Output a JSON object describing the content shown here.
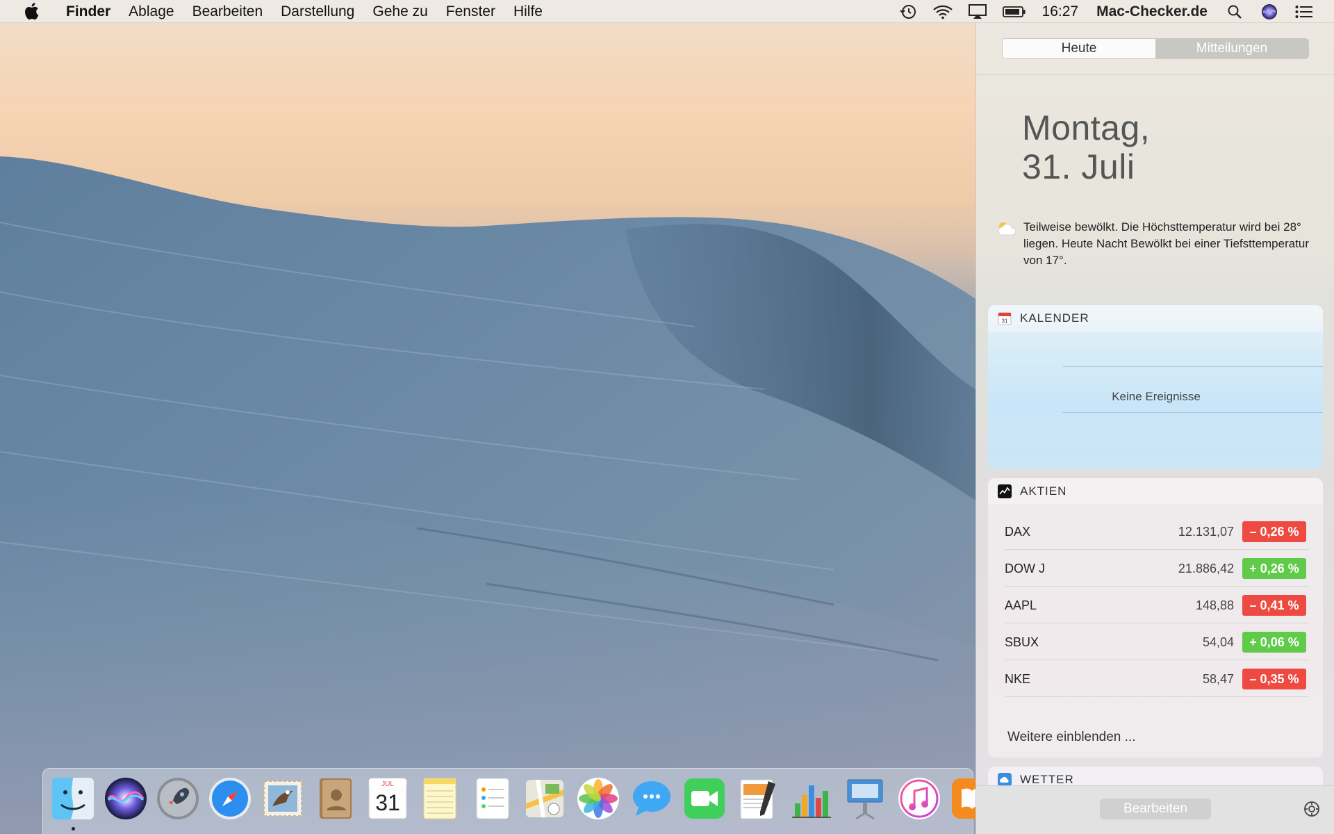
{
  "menubar": {
    "apple_icon": "apple-logo-icon",
    "app_name": "Finder",
    "items": [
      "Ablage",
      "Bearbeiten",
      "Darstellung",
      "Gehe zu",
      "Fenster",
      "Hilfe"
    ],
    "status_icons": [
      "time-machine-icon",
      "wifi-icon",
      "airplay-icon",
      "battery-icon"
    ],
    "clock": "16:27",
    "account": "Mac-Checker.de",
    "right_icons": [
      "spotlight-icon",
      "siri-icon",
      "notification-center-icon"
    ]
  },
  "notification_center": {
    "tabs": [
      {
        "label": "Heute",
        "active": true
      },
      {
        "label": "Mitteilungen",
        "active": false
      }
    ],
    "date_line1": "Montag,",
    "date_line2": "31. Juli",
    "weather_icon": "partly-cloudy-icon",
    "weather_summary": "Teilweise bewölkt. Die Höchsttemperatur wird bei 28° liegen. Heute Nacht Bewölkt bei einer Tiefsttemperatur von 17°.",
    "calendar_widget": {
      "title": "KALENDER",
      "icon": "calendar-icon",
      "empty_text": "Keine Ereignisse"
    },
    "stocks_widget": {
      "title": "AKTIEN",
      "icon": "stocks-icon",
      "rows": [
        {
          "symbol": "DAX",
          "price": "12.131,07",
          "change": "– 0,26 %",
          "direction": "down"
        },
        {
          "symbol": "DOW J",
          "price": "21.886,42",
          "change": "+ 0,26 %",
          "direction": "up"
        },
        {
          "symbol": "AAPL",
          "price": "148,88",
          "change": "– 0,41 %",
          "direction": "down"
        },
        {
          "symbol": "SBUX",
          "price": "54,04",
          "change": "+ 0,06 %",
          "direction": "up"
        },
        {
          "symbol": "NKE",
          "price": "58,47",
          "change": "– 0,35 %",
          "direction": "down"
        }
      ],
      "more_link": "Weitere einblenden ..."
    },
    "weather_widget": {
      "title": "WETTER",
      "icon": "weather-app-icon"
    },
    "edit_button": "Bearbeiten",
    "settings_icon": "settings-gear-icon"
  },
  "dock": {
    "apps": [
      "finder-icon",
      "siri-icon",
      "launchpad-icon",
      "safari-icon",
      "mail-icon",
      "contacts-icon",
      "calendar-icon",
      "notes-icon",
      "reminders-icon",
      "maps-icon",
      "photos-icon",
      "messages-icon",
      "facetime-icon",
      "pages-icon",
      "numbers-icon",
      "keynote-icon",
      "itunes-icon",
      "ibooks-icon"
    ],
    "calendar_month": "JUL",
    "calendar_day": "31"
  },
  "colors": {
    "stock_down": "#ef4a42",
    "stock_up": "#5fcb49",
    "menubar": "#eeeae4"
  }
}
